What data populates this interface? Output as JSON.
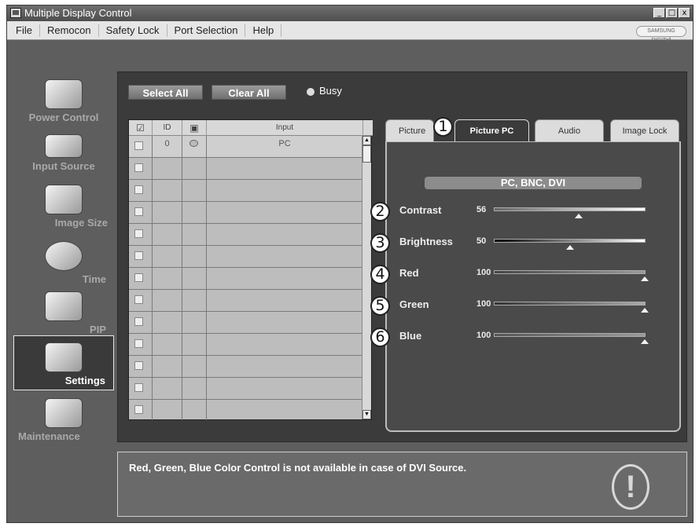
{
  "window": {
    "title": "Multiple Display Control",
    "controls": [
      "_",
      "□",
      "x"
    ]
  },
  "menu": {
    "items": [
      "File",
      "Remocon",
      "Safety Lock",
      "Port Selection",
      "Help"
    ],
    "brand": "SAMSUNG DIGITall"
  },
  "sidebar": {
    "items": [
      {
        "label": "Power Control",
        "icon": "power-control-icon"
      },
      {
        "label": "Input Source",
        "icon": "input-source-icon"
      },
      {
        "label": "Image Size",
        "icon": "image-size-icon"
      },
      {
        "label": "Time",
        "icon": "clock-icon"
      },
      {
        "label": "PIP",
        "icon": "pip-icon"
      },
      {
        "label": "Settings",
        "icon": "settings-icon",
        "selected": true
      },
      {
        "label": "Maintenance",
        "icon": "maintenance-icon"
      }
    ]
  },
  "toolbar": {
    "select_all": "Select All",
    "clear_all": "Clear All",
    "busy": "Busy"
  },
  "table": {
    "headers": {
      "check": "☑",
      "id": "ID",
      "status": "▣",
      "input": "Input"
    },
    "rows": [
      {
        "id": "0",
        "input": "PC"
      }
    ]
  },
  "tabs": [
    {
      "label": "Picture"
    },
    {
      "label": "Picture PC",
      "active": true
    },
    {
      "label": "Audio"
    },
    {
      "label": "Image Lock"
    }
  ],
  "settings": {
    "source": "PC, BNC, DVI",
    "adjustments": [
      {
        "label": "Contrast",
        "value": "56",
        "fraction": 0.56
      },
      {
        "label": "Brightness",
        "value": "50",
        "fraction": 0.5
      },
      {
        "label": "Red",
        "value": "100",
        "fraction": 1.0
      },
      {
        "label": "Green",
        "value": "100",
        "fraction": 1.0
      },
      {
        "label": "Blue",
        "value": "100",
        "fraction": 1.0
      }
    ]
  },
  "callouts": [
    "1",
    "2",
    "3",
    "4",
    "5",
    "6"
  ],
  "message": "Red, Green, Blue Color Control is not available in case of DVI Source.",
  "warning_glyph": "!"
}
